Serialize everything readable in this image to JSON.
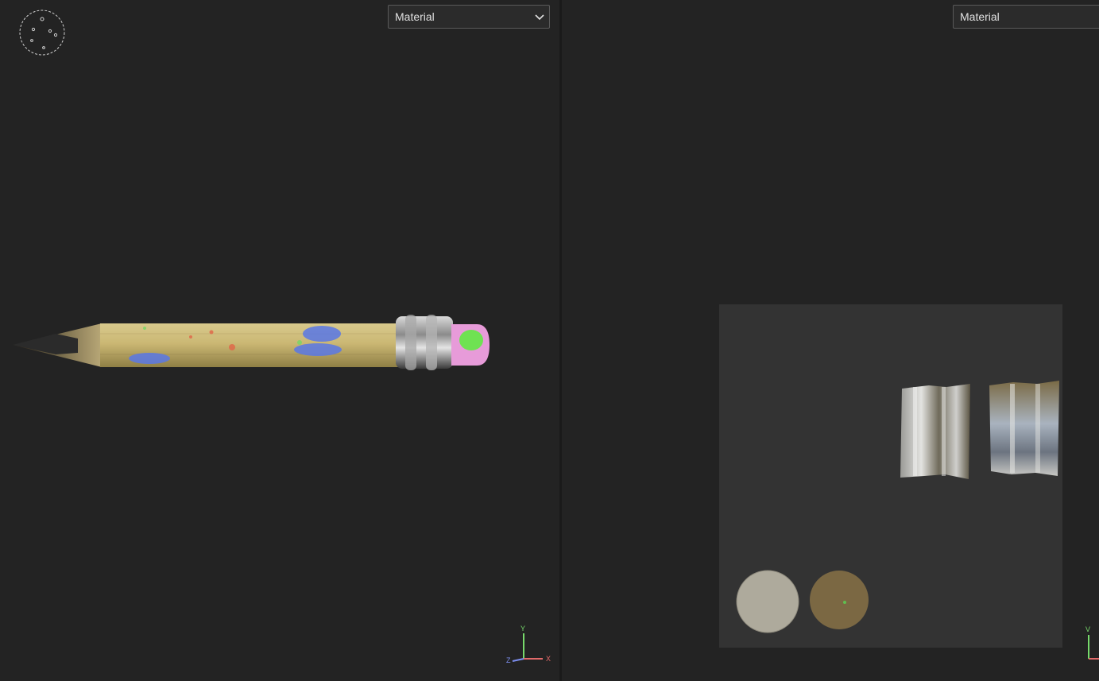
{
  "viewport_3d": {
    "shading_mode": "Material",
    "axes": {
      "y": "Y",
      "x": "X",
      "z": "Z"
    }
  },
  "viewport_2d": {
    "shading_mode": "Material",
    "axes": {
      "y": "V"
    }
  },
  "colors": {
    "background": "#232323",
    "uv_canvas": "#333333",
    "axis_x": "#e26a6a",
    "axis_y": "#77d96b",
    "axis_z": "#7d8ff0"
  },
  "icons": [
    "camera-gizmo-icon",
    "chevron-down-icon",
    "axis-gizmo-icon"
  ]
}
